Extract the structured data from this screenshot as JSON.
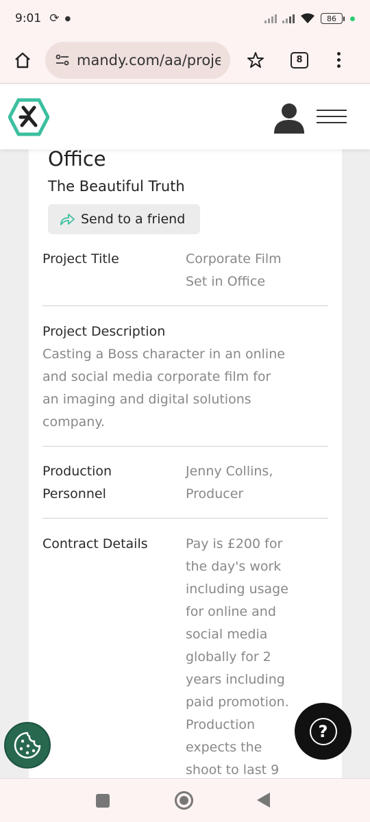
{
  "status_bar": {
    "time": "9:01",
    "battery": "86"
  },
  "browser": {
    "url": "mandy.com/aa/project",
    "tab_count": "8"
  },
  "project": {
    "title_partial": "Office",
    "company": "The Beautiful Truth",
    "send_label": "Send to a friend",
    "details": {
      "title_label": "Project Title",
      "title_value_line1": "Corporate Film",
      "title_value_line2": "Set in Office",
      "description_label": "Project Description",
      "description_lines": [
        "Casting a Boss character in an online",
        "and social media corporate film for",
        "an imaging and digital solutions",
        "company."
      ],
      "personnel_label_line1": "Production",
      "personnel_label_line2": "Personnel",
      "personnel_value_line1": "Jenny Collins,",
      "personnel_value_line2": "Producer",
      "contract_label": "Contract Details",
      "contract_lines": [
        "Pay is £200 for",
        "the day's work",
        "including usage",
        "for online and",
        "social media",
        "globally for 2",
        "years including",
        "paid promotion.",
        "Production",
        "expects the",
        "shoot to last 9"
      ]
    }
  },
  "help_button": {
    "symbol": "?"
  },
  "colors": {
    "brand_teal": "#3bbf9f",
    "cookie_green": "#27684f"
  }
}
